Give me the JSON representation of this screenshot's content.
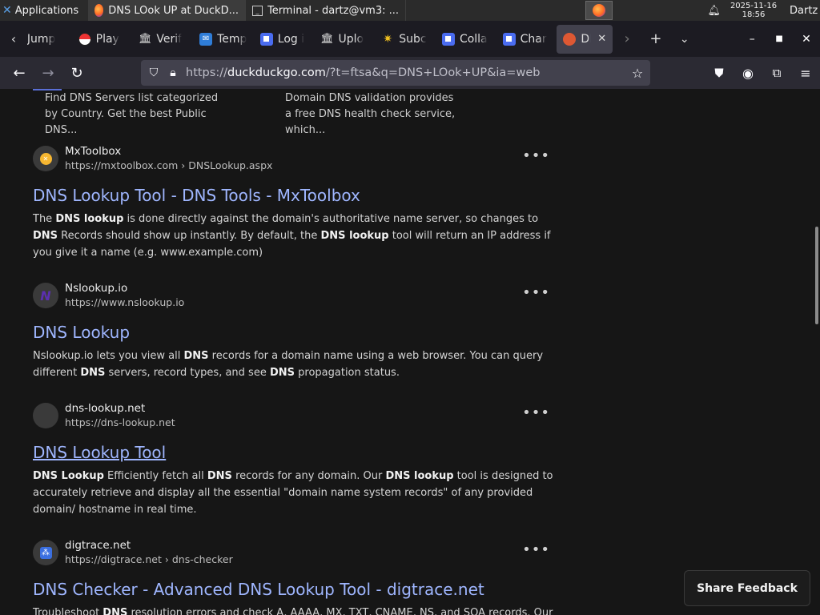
{
  "panel": {
    "apps_label": "Applications",
    "tasks": [
      {
        "label": "DNS LOok UP at DuckD...",
        "icon": "firefox-icon",
        "active": true
      },
      {
        "label": "Terminal - dartz@vm3: ...",
        "icon": "terminal-icon",
        "active": false
      }
    ],
    "clock_date": "2025-11-16",
    "clock_time": "18:56",
    "user": "Dartz"
  },
  "tabs": [
    {
      "label": "Jump",
      "icon": "page-icon"
    },
    {
      "label": "Play",
      "icon": "pokeball-icon"
    },
    {
      "label": "Verif",
      "icon": "bank-icon"
    },
    {
      "label": "Temp",
      "icon": "mail-icon"
    },
    {
      "label": "Log i",
      "icon": "roblox-icon"
    },
    {
      "label": "Uplo",
      "icon": "bank-icon"
    },
    {
      "label": "Subc",
      "icon": "star-icon"
    },
    {
      "label": "Colla",
      "icon": "roblox-icon"
    },
    {
      "label": "Char",
      "icon": "roblox-icon"
    },
    {
      "label": "DN",
      "icon": "duckduckgo-icon",
      "active": true
    }
  ],
  "url": {
    "prefix": "https://",
    "domain": "duckduckgo.com",
    "path": "/?t=ftsa&q=DNS+LOok+UP&ia=web"
  },
  "previous": {
    "left_snippet": "Find DNS Servers list categorized by Country. Get the best Public DNS...",
    "right_snippet": "Domain DNS validation provides a free DNS health check service, which..."
  },
  "results": [
    {
      "site": "MxToolbox",
      "url": "https://mxtoolbox.com › DNSLookup.aspx",
      "title": "DNS Lookup Tool - DNS Tools - MxToolbox",
      "snippet_parts": [
        "The ",
        "DNS lookup",
        " is done directly against the domain's authoritative name server, so changes to ",
        "DNS",
        " Records should show up instantly. By default, the ",
        "DNS lookup",
        " tool will return an IP address if you give it a name (e.g. www.example.com)"
      ]
    },
    {
      "site": "Nslookup.io",
      "url": "https://www.nslookup.io",
      "title": "DNS Lookup",
      "snippet_parts": [
        "Nslookup.io lets you view all ",
        "DNS",
        " records for a domain name using a web browser. You can query different ",
        "DNS",
        " servers, record types, and see ",
        "DNS",
        " propagation status."
      ]
    },
    {
      "site": "dns-lookup.net",
      "url": "https://dns-lookup.net",
      "title": "DNS Lookup Tool",
      "snippet_parts": [
        "",
        "DNS Lookup",
        " Efficiently fetch all ",
        "DNS",
        " records for any domain. Our ",
        "DNS lookup",
        " tool is designed to accurately retrieve and display all the essential \"domain name system records\" of any provided domain/ hostname in real time."
      ]
    },
    {
      "site": "digtrace.net",
      "url": "https://digtrace.net › dns-checker",
      "title": "DNS Checker - Advanced DNS Lookup Tool - digtrace.net",
      "snippet_parts": [
        "Troubleshoot ",
        "DNS",
        " resolution errors and check A, AAAA, MX, TXT, CNAME, NS, and SOA records. Our"
      ]
    }
  ],
  "feedback_label": "Share Feedback",
  "more_glyph": "•••"
}
